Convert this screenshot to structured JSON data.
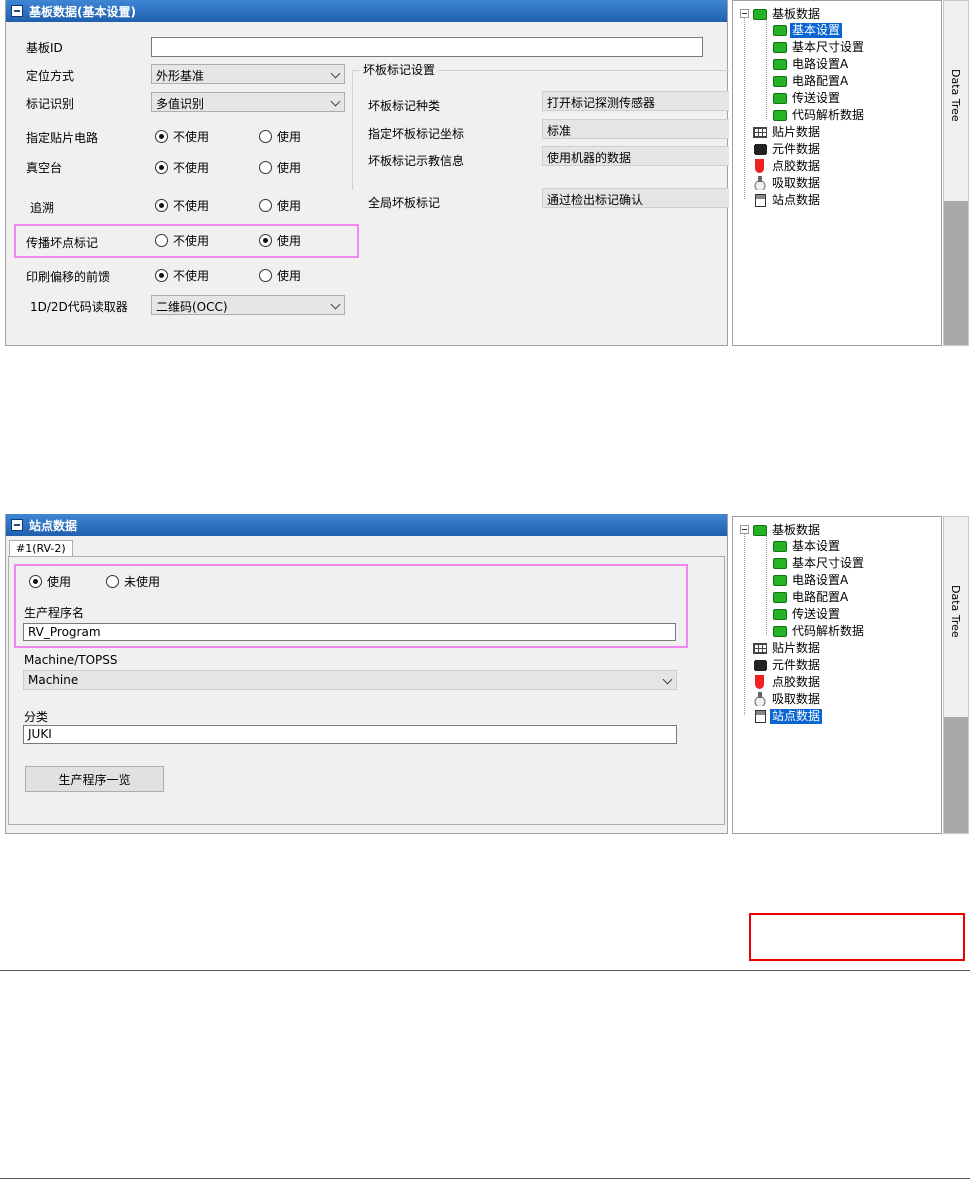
{
  "screen1": {
    "title": "基板数据(基本设置)",
    "board_id": {
      "label": "基板ID",
      "value": ""
    },
    "positioning": {
      "label": "定位方式",
      "value": "外形基准"
    },
    "mark_recognition": {
      "label": "标记识别",
      "value": "多值识别"
    },
    "designated_circuit": {
      "label": "指定贴片电路",
      "option_off": "不使用",
      "option_on": "使用"
    },
    "vacuum_table": {
      "label": "真空台",
      "option_off": "不使用",
      "option_on": "使用"
    },
    "traceability": {
      "label": "追溯",
      "option_off": "不使用",
      "option_on": "使用"
    },
    "propagate_bad_mark": {
      "label": "传播坏点标记",
      "option_off": "不使用",
      "option_on": "使用"
    },
    "print_offset_feedback": {
      "label": "印刷偏移的前馈",
      "option_off": "不使用",
      "option_on": "使用"
    },
    "code_reader": {
      "label": "1D/2D代码读取器",
      "value": "二维码(OCC)"
    },
    "bad_mark_group": {
      "title": "坏板标记设置",
      "type": {
        "label": "坏板标记种类",
        "value": "打开标记探测传感器"
      },
      "coordinate": {
        "label": "指定坏板标记坐标",
        "value": "标准"
      },
      "teach_info": {
        "label": "坏板标记示教信息",
        "value": "使用机器的数据"
      },
      "global": {
        "label": "全局坏板标记",
        "value": "通过检出标记确认"
      }
    },
    "tree": {
      "root": "基板数据",
      "children": [
        "基本设置",
        "基本尺寸设置",
        "电路设置A",
        "电路配置A",
        "传送设置",
        "代码解析数据"
      ],
      "others": [
        "贴片数据",
        "元件数据",
        "点胶数据",
        "吸取数据",
        "站点数据"
      ]
    },
    "side_tab": "Data Tree"
  },
  "screen2": {
    "title": "站点数据",
    "tab": "#1(RV-2)",
    "use_option": "使用",
    "unused_option": "未使用",
    "program_name": {
      "label": "生产程序名",
      "value": "RV_Program"
    },
    "machine_topss": {
      "label": "Machine/TOPSS",
      "value": "Machine"
    },
    "category": {
      "label": "分类",
      "value": "JUKI"
    },
    "program_list_button": "生产程序一览",
    "tree": {
      "root": "基板数据",
      "children": [
        "基本设置",
        "基本尺寸设置",
        "电路设置A",
        "电路配置A",
        "传送设置",
        "代码解析数据"
      ],
      "others": [
        "贴片数据",
        "元件数据",
        "点胶数据",
        "吸取数据",
        "站点数据"
      ]
    },
    "side_tab": "Data Tree"
  },
  "colors": {
    "titlebar": "#2a6fc0",
    "highlight": "#ee88ee",
    "selection": "#0a64d2",
    "red_box": "#e00000"
  }
}
